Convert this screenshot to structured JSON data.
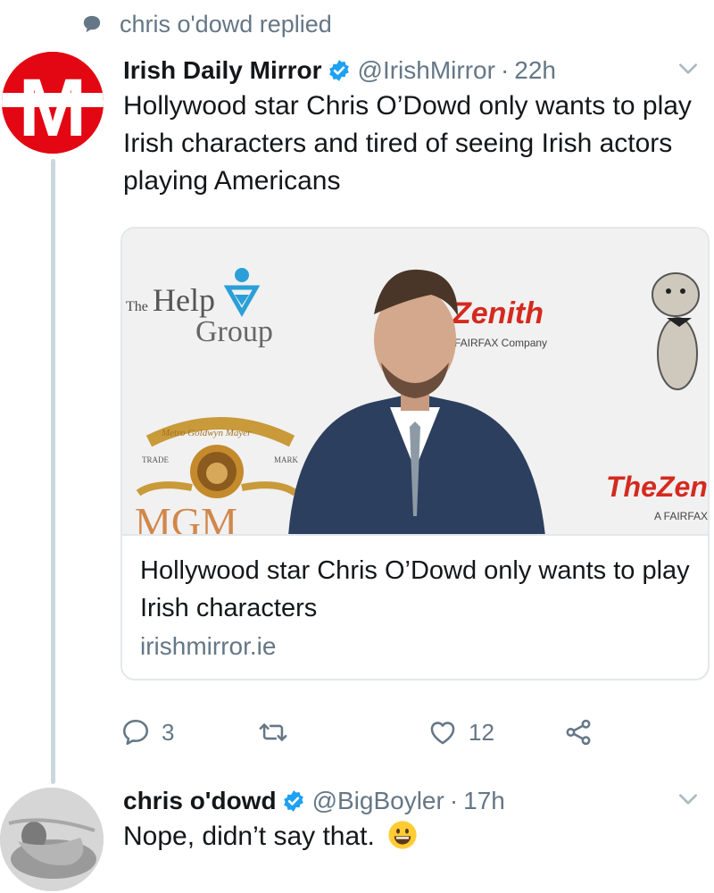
{
  "context": {
    "text": "chris o'dowd replied"
  },
  "tweet1": {
    "name": "Irish Daily Mirror",
    "handle": "@IrishMirror",
    "separator": "·",
    "time": "22h",
    "text": "Hollywood star Chris O’Dowd only wants to play Irish characters and tired of seeing Irish actors playing Americans",
    "avatar_letter": "M",
    "card": {
      "title": "Hollywood star Chris O’Dowd only wants to play Irish characters",
      "domain": "irishmirror.ie",
      "image": {
        "help_group_the": "The",
        "help_group_help": "Help",
        "help_group_group": "Group",
        "zenith": "Zenith",
        "fairfax_company": "FAIRFAX Company",
        "mgm_ribbon": "Metro Goldwyn Mayer",
        "mgm_trade": "TRADE",
        "mgm_mark": "MARK",
        "mgm_word": "MGM",
        "thezen": "TheZen",
        "a_fairfax": "A FAIRFAX"
      }
    },
    "actions": {
      "reply_count": "3",
      "like_count": "12"
    }
  },
  "tweet2": {
    "name": "chris o'dowd",
    "handle": "@BigBoyler",
    "separator": "·",
    "time": "17h",
    "text": "Nope, didn’t say that."
  },
  "colors": {
    "text_primary": "#14171a",
    "text_secondary": "#657786",
    "verified_blue": "#1da1f2",
    "mirror_red": "#e30613",
    "thread_line": "#ccd6dd",
    "card_border": "#e1e8ed"
  }
}
